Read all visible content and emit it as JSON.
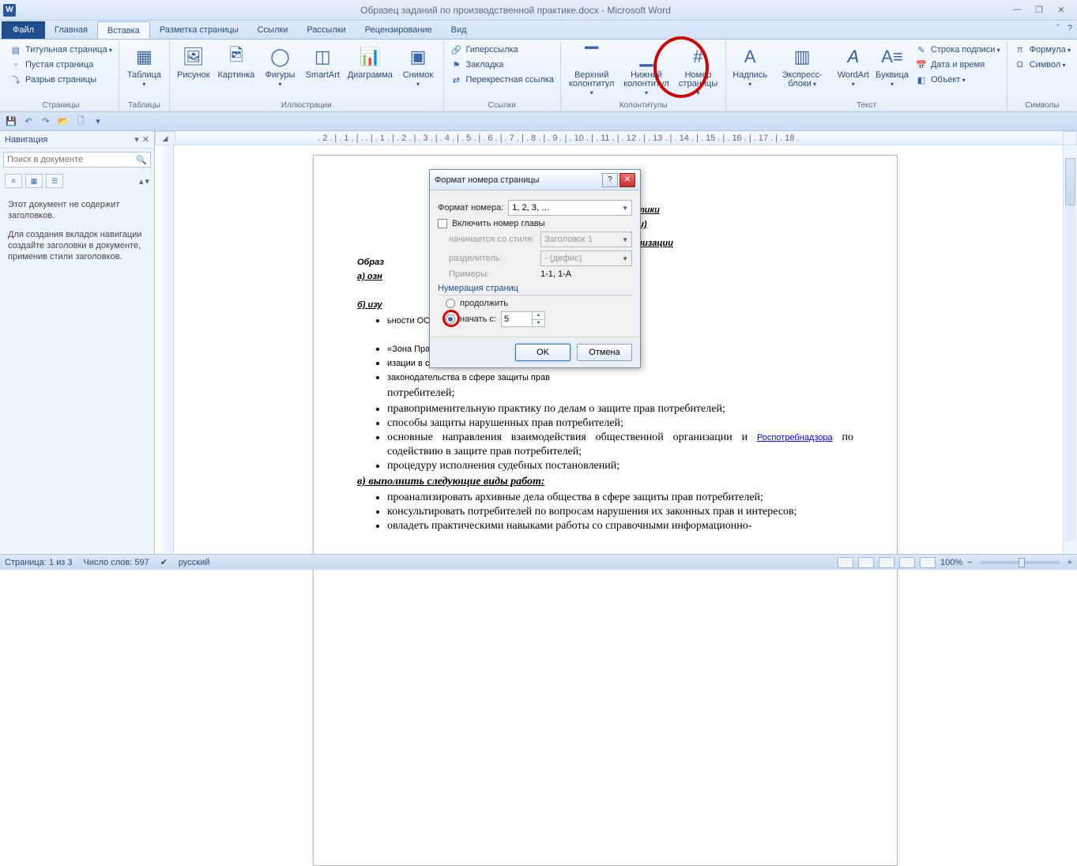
{
  "title": "Образец заданий по производственной практике.docx - Microsoft Word",
  "tabs": {
    "file": "Файл",
    "t0": "Главная",
    "t1": "Вставка",
    "t2": "Разметка страницы",
    "t3": "Ссылки",
    "t4": "Рассылки",
    "t5": "Рецензирование",
    "t6": "Вид"
  },
  "ribbon": {
    "pages": {
      "label": "Страницы",
      "cover": "Титульная страница",
      "blank": "Пустая страница",
      "break": "Разрыв страницы"
    },
    "tables": {
      "label": "Таблицы",
      "btn": "Таблица"
    },
    "illus": {
      "label": "Иллюстрации",
      "pic": "Рисунок",
      "img": "Картинка",
      "shapes": "Фигуры",
      "smartart": "SmartArt",
      "chart": "Диаграмма",
      "screen": "Снимок"
    },
    "links": {
      "label": "Ссылки",
      "hyper": "Гиперссылка",
      "bookmark": "Закладка",
      "cross": "Перекрестная ссылка"
    },
    "headfoot": {
      "label": "Колонтитулы",
      "header": "Верхний\nколонтитул",
      "footer": "Нижний\nколонтитул",
      "pagenum": "Номер\nстраницы"
    },
    "text": {
      "label": "Текст",
      "textbox": "Надпись",
      "quick": "Экспресс-блоки",
      "wordart": "WordArt",
      "dropcap": "Буквица",
      "sig": "Строка подписи",
      "date": "Дата и время",
      "obj": "Объект"
    },
    "symbols": {
      "label": "Символы",
      "formula": "Формула",
      "symbol": "Символ"
    }
  },
  "nav": {
    "title": "Навигация",
    "search_placeholder": "Поиск в документе",
    "msg1": "Этот документ не содержит заголовков.",
    "msg2": "Для создания вкладок навигации создайте заголовки в документе, применив стили заголовков."
  },
  "dialog": {
    "title": "Формат номера страницы",
    "fmt_label": "Формат номера:",
    "fmt_value": "1, 2, 3, …",
    "include": "Включить номер главы",
    "starts_with": "начинается со стиля:",
    "starts_value": "Заголовок 1",
    "sep": "разделитель:",
    "sep_value": "-   (дефис)",
    "examples": "Примеры:",
    "examples_value": "1-1, 1-A",
    "numbering": "Нумерация страниц",
    "continue": "продолжить",
    "startat": "начать с:",
    "startat_value": "5",
    "ok": "OK",
    "cancel": "Отмена"
  },
  "doc": {
    "h1": "зводственной практики",
    "h2": "невника практики)",
    "h3": "дическом отделе организации",
    "intro": "Образ",
    "a": "а) озн",
    "b": "б) изу",
    "li_b1": "ьности ОО ЗПП «Зона Правозащиты»;",
    "li_b2": "«Зона Правозащиты»;",
    "li_b3": "изации в сфере защиты прав потребителей;",
    "li_b4": " законодательства в сфере защиты прав",
    "li_b4b": "потребителей;",
    "li_b5": "правоприменительную практику по делам о защите прав потребителей;",
    "li_b6": " способы  защиты нарушенных прав потребителей;",
    "li_b7": "основные направления взаимодействия общественной организации и Роспотребнадзора по содействию в защите прав потребителей;",
    "rospot": "Роспотребнадзора",
    "li_b8": " процедуру исполнения судебных постановлений;",
    "c": "в) выполнить следующие виды работ:",
    "li_c1": "проанализировать архивные дела общества в сфере защиты прав потребителей;",
    "li_c2": "консультировать потребителей по вопросам нарушения их законных прав и интересов;",
    "li_c3": "овладеть практическими навыками работы со справочными информационно-"
  },
  "status": {
    "page": "Страница: 1 из 3",
    "words": "Число слов: 597",
    "lang": "русский",
    "zoom": "100%"
  },
  "ruler": ". 2 . | . 1 . | .   . | . 1 . | . 2 . | . 3 . | . 4 . | . 5 . | . 6 . | . 7 . | . 8 . | . 9 . | . 10 . | . 11 . | . 12 . | . 13 . | . 14 . | . 15 . | . 16 . | . 17 . | . 18 ."
}
